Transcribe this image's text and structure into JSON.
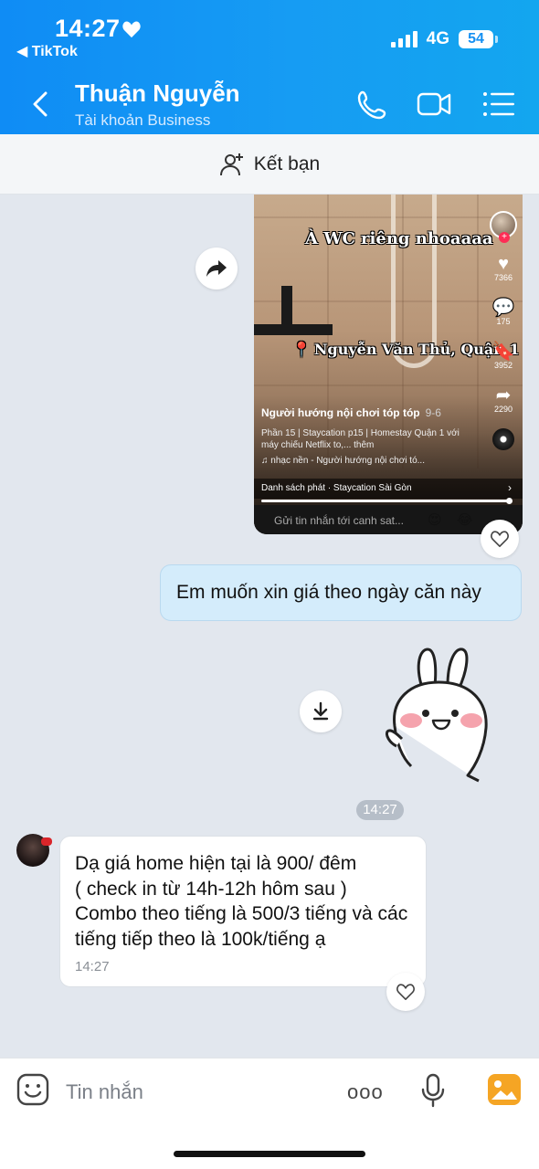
{
  "status_bar": {
    "time": "14:27",
    "back_app": "◀ TikTok",
    "network": "4G",
    "battery": "54"
  },
  "header": {
    "contact_name": "Thuận Nguyễn",
    "contact_subtitle": "Tài khoản Business",
    "accent_color": "#1592f4"
  },
  "friend_bar": {
    "label": "Kết bạn"
  },
  "shared_video": {
    "overlay_title": "À WC riêng nhoaaaa",
    "overlay_location": "Nguyễn Văn Thủ, Quận 1",
    "author": "Người hướng nội chơi tóp tóp",
    "date": "9-6",
    "description": "Phần 15 | Staycation p15 | Homestay Quận 1 với máy chiếu Netflix to,... thêm",
    "music": "♫ nhạc nền - Người hướng nội chơi tó...",
    "playlist": "Danh sách phát · Staycation Sài Gòn",
    "comment_placeholder": "Gửi tin nhắn tới canh sat...",
    "likes": "7366",
    "comments": "175",
    "saves": "3952",
    "shares": "2290"
  },
  "messages": {
    "outgoing_text": "Em muốn xin giá theo ngày căn này",
    "timestamp_chip": "14:27",
    "incoming_text": "Dạ giá home hiện tại là 900/ đêm\n( check in từ 14h-12h hôm sau )\nCombo theo tiếng là 500/3 tiếng và các tiếng tiếp theo là 100k/tiếng ạ",
    "incoming_time": "14:27"
  },
  "composer": {
    "placeholder": "Tin nhắn",
    "more_label": "ooo"
  }
}
